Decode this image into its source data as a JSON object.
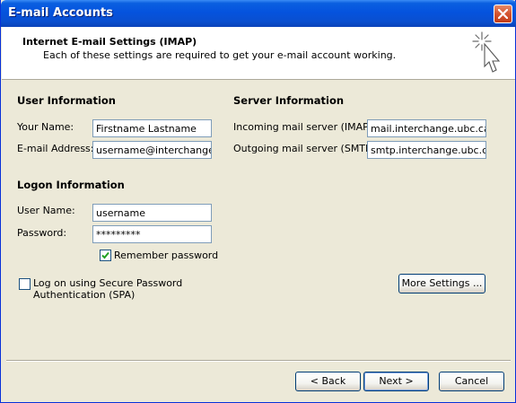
{
  "window": {
    "title": "E-mail Accounts"
  },
  "header": {
    "title": "Internet E-mail Settings (IMAP)",
    "subtitle": "Each of these settings are required to get your e-mail account working."
  },
  "user_info": {
    "section_title": "User Information",
    "name_label": "Your Name:",
    "name_value": "Firstname Lastname",
    "email_label": "E-mail Address:",
    "email_value": "username@interchange.ub"
  },
  "server_info": {
    "section_title": "Server Information",
    "incoming_label": "Incoming mail server (IMAP):",
    "incoming_value": "mail.interchange.ubc.ca",
    "outgoing_label": "Outgoing mail server (SMTP):",
    "outgoing_value": "smtp.interchange.ubc.ca"
  },
  "logon_info": {
    "section_title": "Logon Information",
    "username_label": "User Name:",
    "username_value": "username",
    "password_label": "Password:",
    "password_value": "*********",
    "remember_label": "Remember password",
    "remember_checked": true
  },
  "spa": {
    "label_line1": "Log on using Secure Password",
    "label_line2": "Authentication (SPA)",
    "checked": false
  },
  "buttons": {
    "more_settings": "More Settings ...",
    "back": "< Back",
    "next": "Next >",
    "cancel": "Cancel"
  },
  "icons": {
    "close": "close-icon",
    "wizard": "cursor-sparkle-icon",
    "check": "checkmark-icon"
  },
  "colors": {
    "titlebar": "#0553de",
    "dialog_bg": "#ece9d8",
    "field_border": "#7f9db9",
    "close_button": "#d4532e",
    "checkmark": "#21a121"
  }
}
